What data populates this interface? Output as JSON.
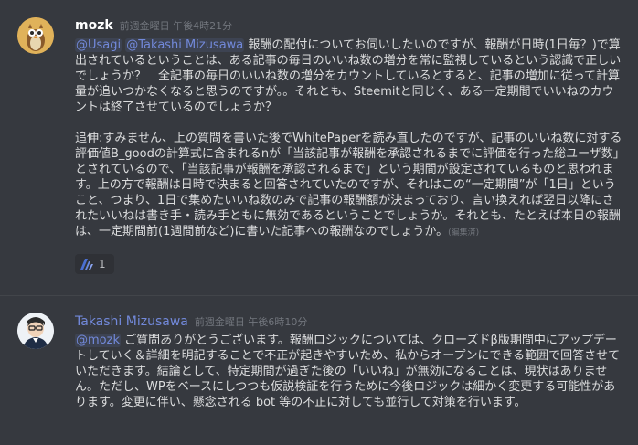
{
  "messages": [
    {
      "username": "mozk",
      "username_color": "#ffffff",
      "timestamp": "前週金曜日 午後4時21分",
      "mentions": [
        "@Usagi",
        "@Takashi Mizusawa"
      ],
      "text_after_mentions": "報酬の配付についてお伺いしたいのですが、報酬が日時(1日毎？)で算出されているということは、ある記事の毎日のいいね数の増分を常に監視しているという認識で正しいでしょうか？　全記事の毎日のいいね数の増分をカウントしているとすると、記事の増加に従って計算量が追いつかなくなると思うのですが。。それとも、Steemitと同じく、ある一定期間でいいねのカウントは終了させているのでしょうか？",
      "paragraph2": "追伸:すみません、上の質問を書いた後でWhitePaperを読み直したのですが、記事のいいね数に対する評価値B_goodの計算式に含まれるnが「当該記事が報酬を承認されるまでに評価を行った総ユーザ数」とされているので、「当該記事が報酬を承認されるまで」という期間が設定されているものと思われます。上の方で報酬は日時で決まると回答されていたのですが、それはこの“一定期間”が「1日」ということ、つまり、1日で集めたいいね数のみで記事の報酬額が決まっており、言い換えれば翌日以降にされたいいねは書き手・読み手ともに無効であるということでしょうか。それとも、たとえば本日の報酬は、一定期間前(1週間前など)に書いた記事への報酬なのでしょうか。",
      "edited_label": "(編集済)",
      "reaction": {
        "icon": "steem-logo-icon",
        "count": "1"
      }
    },
    {
      "username": "Takashi Mizusawa",
      "username_color": "#7289da",
      "timestamp": "前週金曜日 午後6時10分",
      "mention": "@mozk",
      "text_after_mention": "ご質問ありがとうございます。報酬ロジックについては、クローズドβ版期間中にアップデートしていく＆詳細を明記することで不正が起きやすいため、私からオープンにできる範囲で回答させていただきます。結論として、特定期間が過ぎた後の「いいね」が無効になることは、現状はありません。ただし、WPをベースにしつつも仮説検証を行うために今後ロジックは細かく変更する可能性があります。変更に伴い、懸念される bot 等の不正に対しても並行して対策を行います。"
    }
  ]
}
